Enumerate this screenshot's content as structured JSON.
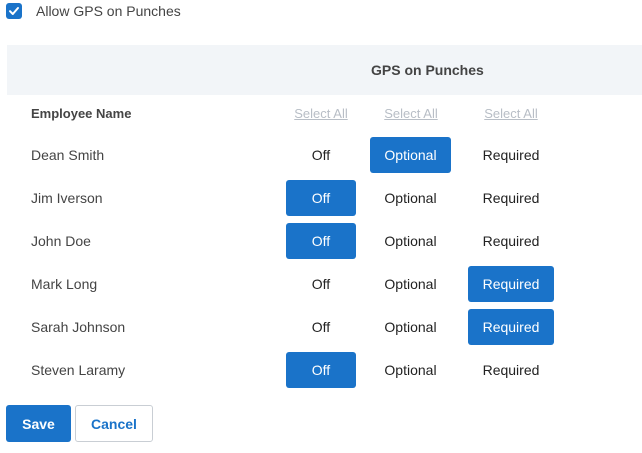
{
  "allow_gps": {
    "label": "Allow GPS on Punches",
    "checked": true
  },
  "header": {
    "title": "GPS on Punches"
  },
  "columns": {
    "name_header": "Employee Name",
    "select_all": [
      "Select All",
      "Select All",
      "Select All"
    ]
  },
  "options": [
    "Off",
    "Optional",
    "Required"
  ],
  "employees": [
    {
      "name": "Dean Smith",
      "selected": "Optional"
    },
    {
      "name": "Jim Iverson",
      "selected": "Off"
    },
    {
      "name": "John Doe",
      "selected": "Off"
    },
    {
      "name": "Mark Long",
      "selected": "Required"
    },
    {
      "name": "Sarah Johnson",
      "selected": "Required"
    },
    {
      "name": "Steven Laramy",
      "selected": "Off"
    }
  ],
  "actions": {
    "save_label": "Save",
    "cancel_label": "Cancel"
  },
  "colors": {
    "accent": "#1a73c9"
  }
}
